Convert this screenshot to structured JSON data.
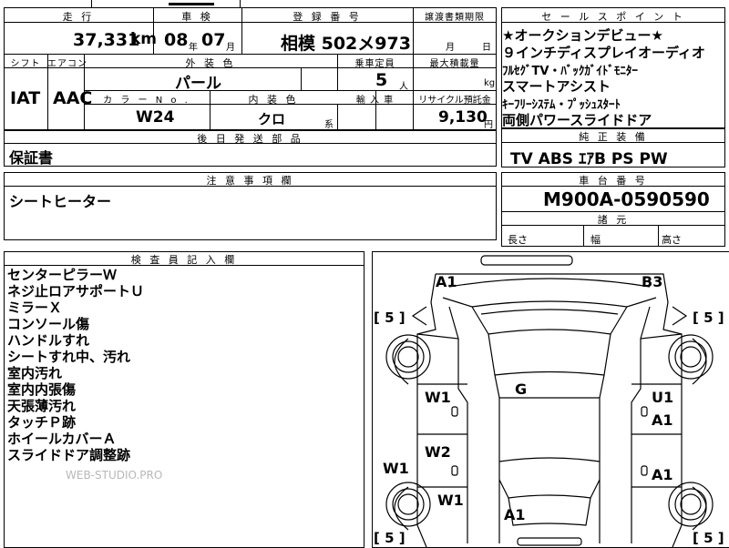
{
  "headers": {
    "mileage": "走 行",
    "inspection": "車 検",
    "registration": "登 録 番 号",
    "transfer_deadline": "譲渡書類期限",
    "shift": "シフト",
    "aircon": "エアコン",
    "exterior_color": "外 装 色",
    "capacity": "乗車定員",
    "max_load": "最大積載量",
    "color_no": "カ ラ ー N o .",
    "interior_color": "内 装 色",
    "import": "輸 入 車",
    "recycle": "リサイクル預託金",
    "delivery_later": "後 日 発 送 部 品",
    "notes": "注 意 事 項 欄",
    "sales_points": "セ ー ル ス ポ イ ン ト",
    "standard_equipment": "純 正 装 備",
    "chassis_no": "車 台 番 号",
    "dimensions": "諸 元",
    "inspector": "検 査 員 記 入 欄"
  },
  "vehicle": {
    "mileage": "37,331",
    "mileage_unit": "km",
    "inspection_year": "08",
    "inspection_year_unit": "年",
    "inspection_month": "07",
    "inspection_month_unit": "月",
    "registration": "相模 502メ973",
    "deadline_month_unit": "月",
    "deadline_day_unit": "日",
    "shift": "IAT",
    "aircon": "AAC",
    "exterior_color": "パール",
    "capacity": "5",
    "capacity_unit": "人",
    "max_load_unit": "kg",
    "color_no": "W24",
    "interior_color": "クロ",
    "interior_suffix": "系",
    "recycle": "9,130",
    "recycle_unit": "円",
    "delivery_later": "保証書",
    "notes": "シートヒーター",
    "chassis_no": "M900A-0590590",
    "length_label": "長さ",
    "width_label": "幅",
    "height_label": "高さ"
  },
  "sales_points": [
    "★オークションデビュー★",
    "９インチディスプレイオーディオ",
    "ﾌﾙｾｸﾞTV・ﾊﾞｯｸｶﾞｲﾄﾞﾓﾆﾀｰ",
    "スマートアシスト",
    "ｷｰﾌﾘｰｼｽﾃﾑ・ﾌﾟｯｼｭｽﾀｰﾄ",
    "両側パワースライドドア"
  ],
  "standard_equipment": "TV ABS ｴｱB PS PW",
  "inspector_notes": [
    "センターピラーＷ",
    "ネジ止ロアサポートＵ",
    "ミラーＸ",
    "コンソール傷",
    "ハンドルすれ",
    "シートすれ中、汚れ",
    "室内汚れ",
    "室内内張傷",
    "天張薄汚れ",
    "タッチＰ跡",
    "ホイールカバーＡ",
    "スライドドア調整跡"
  ],
  "damage_marks": {
    "front_left": "A1",
    "front_right": "B3",
    "roof": "G",
    "left_front_door": "W1",
    "left_rear_door": "W2",
    "left_rear_lower": "W1",
    "left_side": "W1",
    "right_front_upper": "U1",
    "right_front_door": "A1",
    "right_rear_door": "A1",
    "rear": "A1"
  },
  "tires": {
    "front_left": "[ 5 ]",
    "front_right": "[ 5 ]",
    "rear_left": "[ 5 ]",
    "rear_right": "[ 5 ]"
  },
  "watermark": "WEB-STUDIO.PRO"
}
